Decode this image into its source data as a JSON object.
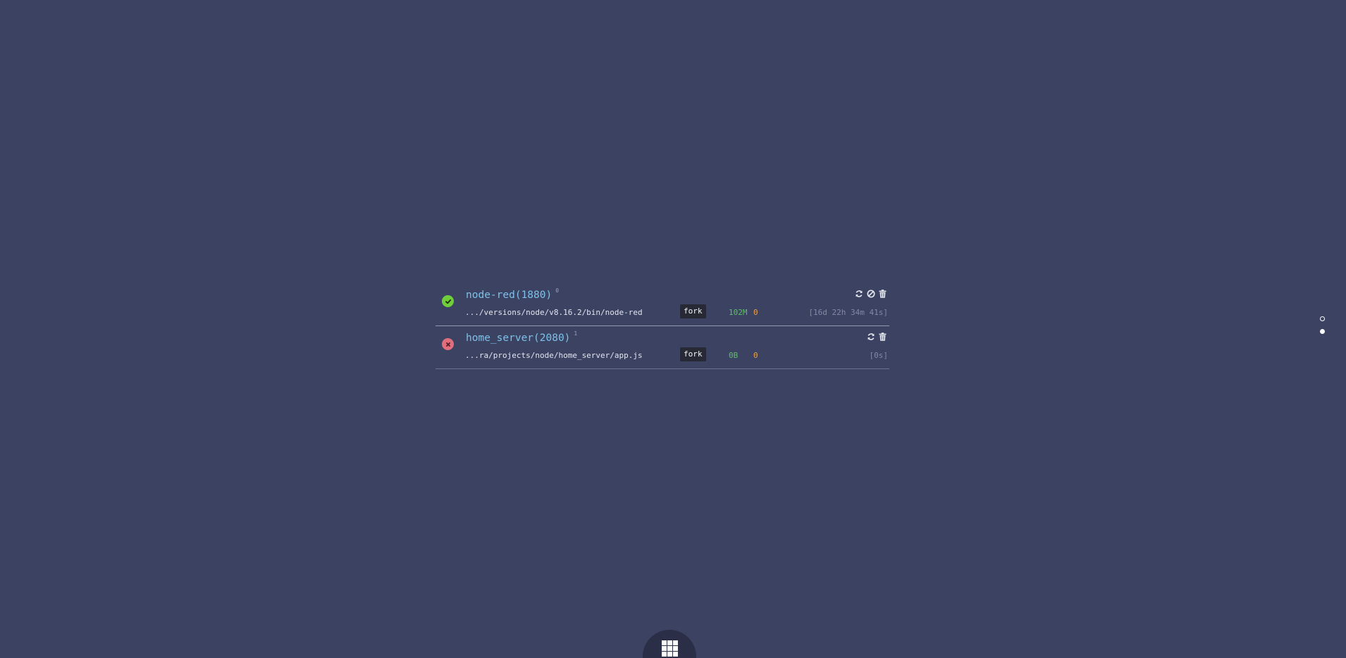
{
  "processes": [
    {
      "name": "node-red(1880)",
      "restarts": "0",
      "status": "online",
      "path": ".../versions/node/v8.16.2/bin/node-red",
      "mode": "fork",
      "memory": "102M",
      "cpu": "0",
      "uptime": "[16d 22h 34m 41s]",
      "actions": [
        "restart-icon",
        "stop-icon",
        "delete-icon"
      ]
    },
    {
      "name": "home_server(2080)",
      "restarts": "1",
      "status": "errored",
      "path": "...ra/projects/node/home_server/app.js",
      "mode": "fork",
      "memory": "0B",
      "cpu": "0",
      "uptime": "[0s]",
      "actions": [
        "restart-icon",
        "delete-icon"
      ]
    }
  ],
  "pager": {
    "pages": 2,
    "active_index": 1
  },
  "launcher": {
    "icon": "grid-icon"
  },
  "colors": {
    "background": "#3b4262",
    "online": "#6fcf3a",
    "errored": "#e06e7c",
    "title": "#7dc2ea",
    "memory": "#5fbf68",
    "cpu": "#e9a04c"
  }
}
